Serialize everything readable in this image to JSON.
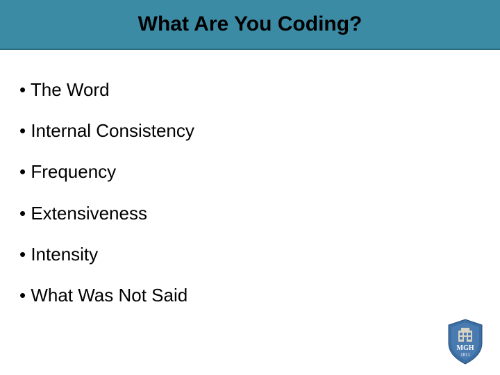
{
  "title": "What Are You Coding?",
  "bullets": [
    "The Word",
    "Internal Consistency",
    "Frequency",
    "Extensiveness",
    "Intensity",
    "What Was Not Said"
  ],
  "logo": {
    "org": "MGH",
    "year": "1811"
  }
}
